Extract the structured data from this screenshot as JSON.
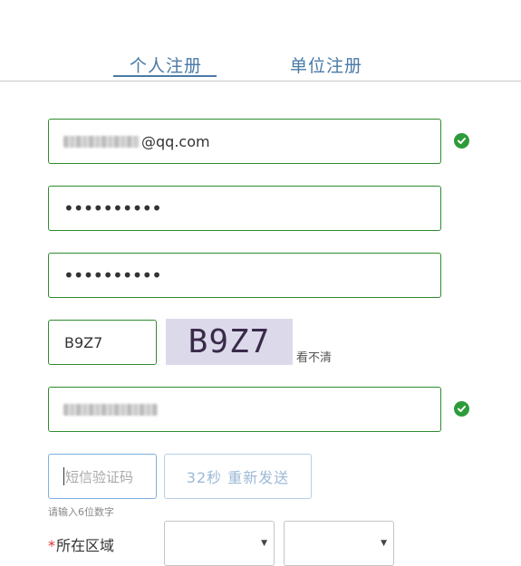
{
  "tabs": [
    {
      "label": "个人注册",
      "active": true
    },
    {
      "label": "单位注册",
      "active": false
    }
  ],
  "email_field": {
    "value_suffix": "@qq.com",
    "valid": true
  },
  "password_field": {
    "masked": "••••••••••"
  },
  "confirm_password_field": {
    "masked": "••••••••••"
  },
  "captcha": {
    "input_value": "B9Z7",
    "image_text": "B9Z7",
    "refresh_label": "看不清"
  },
  "phone_field": {
    "valid": true
  },
  "sms": {
    "placeholder": "短信验证码",
    "resend_label": "32秒 重新发送",
    "hint": "请输入6位数字"
  },
  "region": {
    "required_mark": "*",
    "label": "所在区域",
    "select1_value": "",
    "select2_value": ""
  },
  "colors": {
    "accent": "#4a7aa6",
    "valid_border": "#2e8b2e",
    "check": "#2e9b3a"
  },
  "icons": [
    "check-circle-icon",
    "chevron-down-icon"
  ]
}
